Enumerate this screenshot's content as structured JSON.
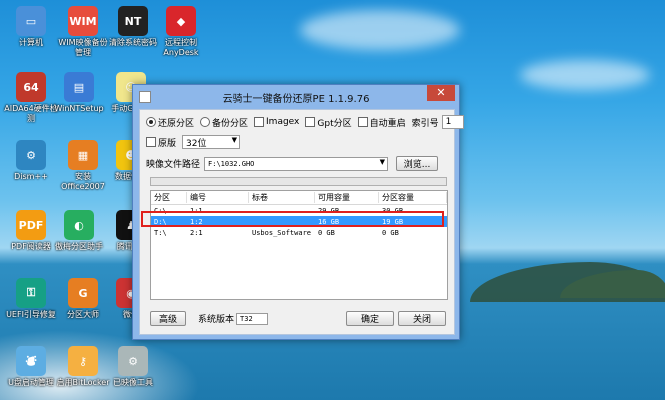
{
  "desktop": {
    "icons": [
      {
        "name": "computer",
        "label": "计算机",
        "color": "#4a90d9",
        "glyph": "▭"
      },
      {
        "name": "wim",
        "label": "WIM映像备份管理",
        "color": "#e74c3c",
        "glyph": "WIM"
      },
      {
        "name": "ntpwd",
        "label": "清除系统密码",
        "color": "#222222",
        "glyph": "NT"
      },
      {
        "name": "anydesk",
        "label": "远程控制AnyDesk",
        "color": "#d9262b",
        "glyph": "◆"
      },
      {
        "name": "aida64",
        "label": "AIDA64硬件检测",
        "color": "#c0392b",
        "glyph": "64"
      },
      {
        "name": "winntsetup",
        "label": "WinNTSetup",
        "color": "#3a7bd5",
        "glyph": "▤"
      },
      {
        "name": "ghost",
        "label": "手动Ghost",
        "color": "#f0e68c",
        "glyph": "☺"
      },
      {
        "name": "dism",
        "label": "Dism++",
        "color": "#2e86c1",
        "glyph": "⚙"
      },
      {
        "name": "office",
        "label": "安装Office2007",
        "color": "#e67e22",
        "glyph": "▦"
      },
      {
        "name": "datarec",
        "label": "数据恢复",
        "color": "#f1c40f",
        "glyph": "☻"
      },
      {
        "name": "pdf",
        "label": "PDF阅读器",
        "color": "#f39c12",
        "glyph": "PDF"
      },
      {
        "name": "partassist",
        "label": "傲梅分区助手",
        "color": "#27ae60",
        "glyph": "◐"
      },
      {
        "name": "qq",
        "label": "腾讯QQ",
        "color": "#111111",
        "glyph": "♟"
      },
      {
        "name": "uefi",
        "label": "UEFI引导修复",
        "color": "#16a085",
        "glyph": "⚿"
      },
      {
        "name": "diskgenius",
        "label": "分区大师",
        "color": "#e67e22",
        "glyph": "G"
      },
      {
        "name": "wx",
        "label": "微信",
        "color": "#cc3333",
        "glyph": "◉"
      },
      {
        "name": "usb",
        "label": "U盘启动管理",
        "color": "#5dade2",
        "glyph": "⛇"
      },
      {
        "name": "bitlocker",
        "label": "启用BitLocker",
        "color": "#f5b041",
        "glyph": "⚷"
      },
      {
        "name": "prog",
        "label": "已映像工具",
        "color": "#aab7b8",
        "glyph": "⚙"
      }
    ]
  },
  "window": {
    "title": "云骑士一键备份还原PE 1.1.9.76",
    "close": "✕",
    "mode_restore": "还原分区",
    "mode_backup": "备份分区",
    "imagex": "Imagex",
    "gpt": "Gpt分区",
    "auto_restart": "自动重启",
    "volume_label": "索引号",
    "volume_value": "1",
    "original": "原版",
    "bits": "32位",
    "image_path_label": "映像文件路径",
    "image_path": "F:\\1032.GHO",
    "browse": "浏览...",
    "table": {
      "headers": [
        "分区",
        "编号",
        "标卷",
        "可用容量",
        "分区容量"
      ],
      "rows": [
        [
          "C:\\",
          "1:1",
          "",
          "29 GB",
          "30 GB"
        ],
        [
          "D:\\",
          "1:2",
          "",
          "16 GB",
          "19 GB"
        ],
        [
          "T:\\",
          "2:1",
          "Usbos_Software",
          "0 GB",
          "0 GB"
        ]
      ],
      "selected_index": 1
    },
    "advanced": "高级",
    "sysver_label": "系统版本",
    "sysver_value": "T32",
    "ok": "确定",
    "close_btn": "关闭"
  }
}
